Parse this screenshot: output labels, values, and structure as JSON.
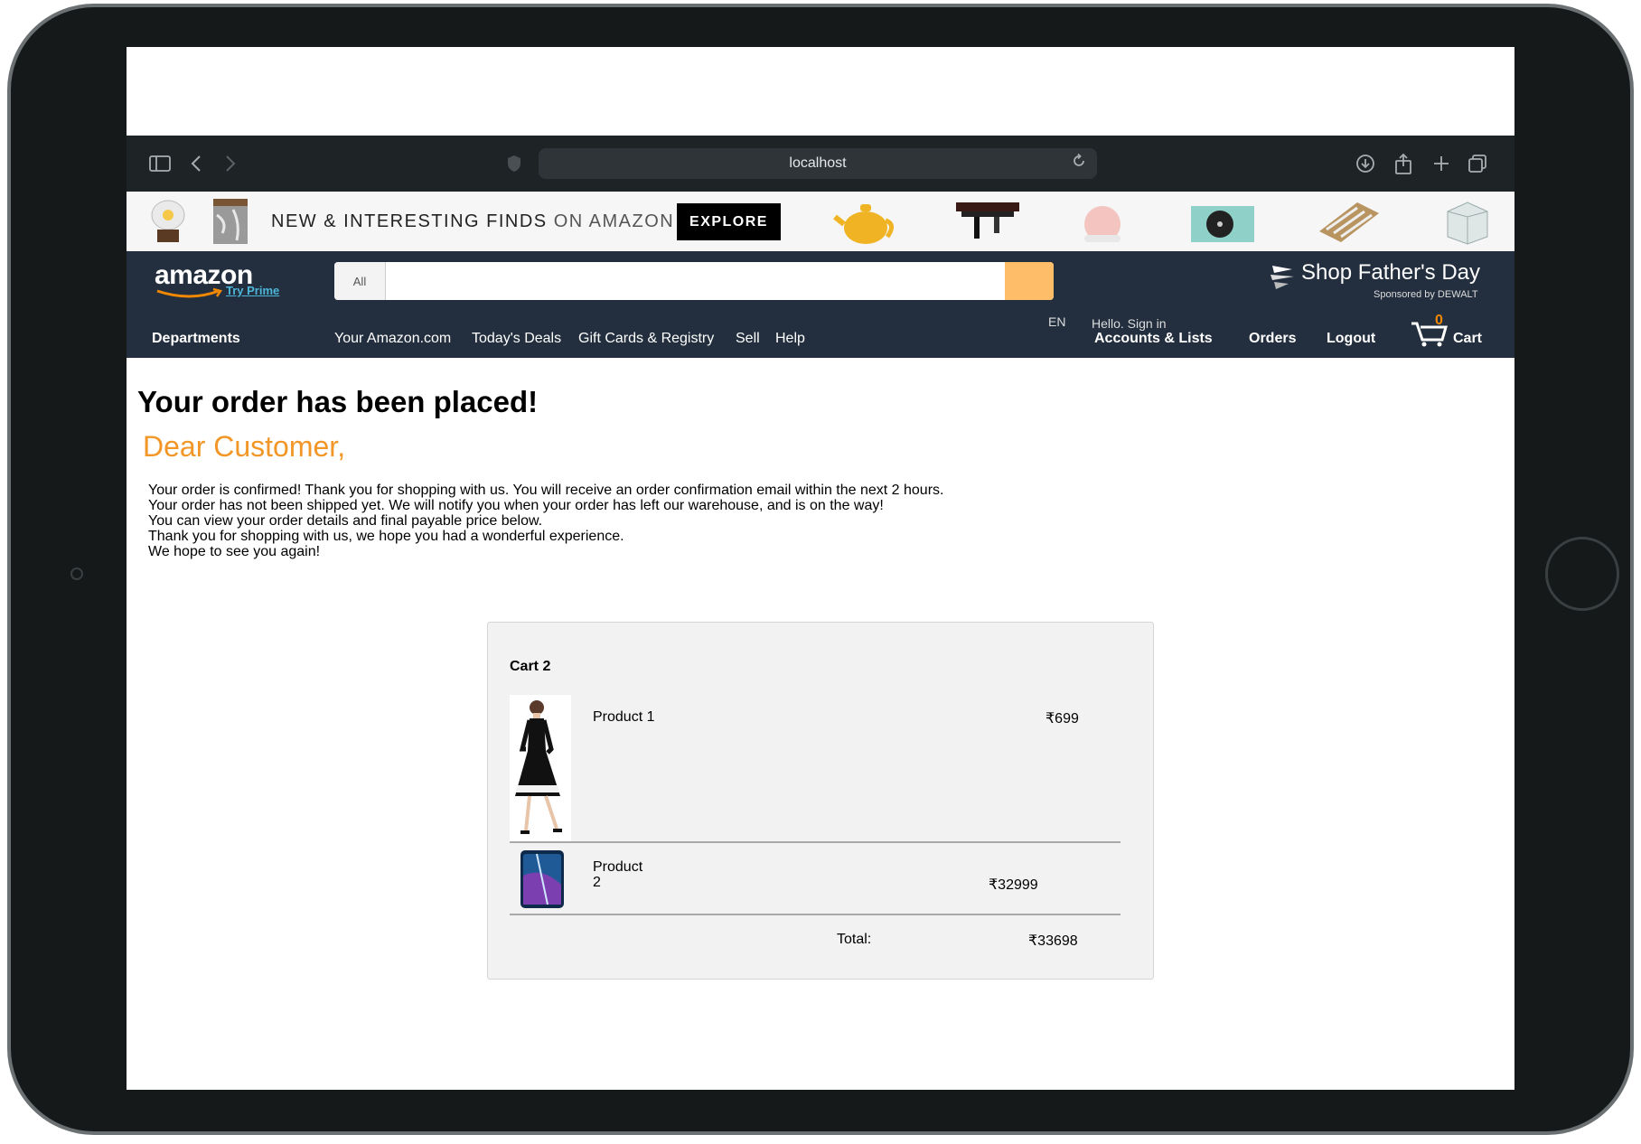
{
  "browser": {
    "url": "localhost"
  },
  "promo": {
    "text_main": "NEW & INTERESTING FINDS",
    "text_light": "ON AMAZON",
    "explore_label": "EXPLORE"
  },
  "nav": {
    "logo": "amazon",
    "try_prime": "Try Prime",
    "search_scope": "All",
    "search_placeholder": "",
    "fathers_day": "Shop Father's Day",
    "sponsored": "Sponsored by DEWALT",
    "departments": "Departments",
    "links": [
      "Your Amazon.com",
      "Today's Deals",
      "Gift Cards & Registry",
      "Sell",
      "Help"
    ],
    "language": "EN",
    "hello": "Hello. Sign in",
    "accounts": "Accounts & Lists",
    "orders": "Orders",
    "logout": "Logout",
    "cart_count": "0",
    "cart_label": "Cart"
  },
  "page": {
    "title": "Your order has been placed!",
    "greeting": "Dear Customer,",
    "message_lines": [
      "Your order is confirmed! Thank you for shopping with us. You will receive an order confirmation email within the next 2 hours.",
      "Your order has not been shipped yet. We will notify you when your order has left our warehouse, and is on the way!",
      "You can view your order details and final payable price below.",
      "Thank you for shopping with us, we hope you had a wonderful experience.",
      "We hope to see you again!"
    ]
  },
  "cart": {
    "title": "Cart 2",
    "items": [
      {
        "name": "Product 1",
        "price": "₹699"
      },
      {
        "name": "Product 2",
        "price": "₹32999"
      }
    ],
    "total_label": "Total:",
    "total_value": "₹33698"
  }
}
